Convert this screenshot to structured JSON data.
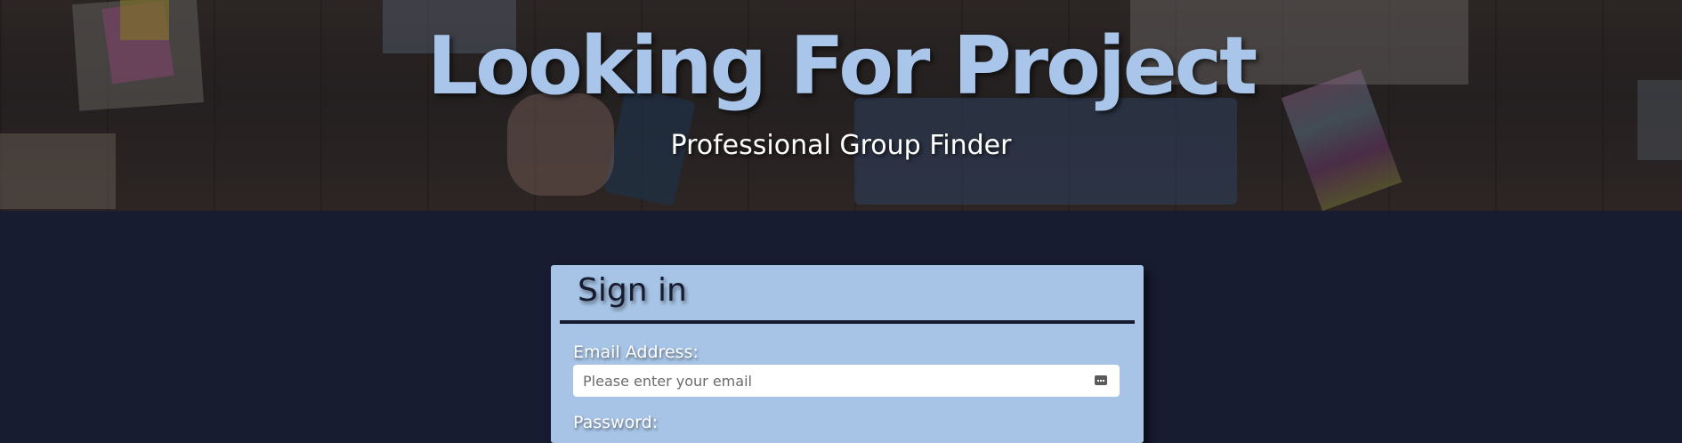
{
  "hero": {
    "title": "Looking For Project",
    "subtitle": "Professional Group Finder"
  },
  "signin": {
    "heading": "Sign in",
    "email_label": "Email Address:",
    "email_placeholder": "Please enter your email",
    "email_value": "",
    "password_label": "Password:"
  },
  "icons": {
    "email_field_icon": "password-autofill-icon"
  },
  "colors": {
    "accent": "#a7c4e6",
    "page_background": "#171c31",
    "title_color": "#a9c6ea"
  }
}
